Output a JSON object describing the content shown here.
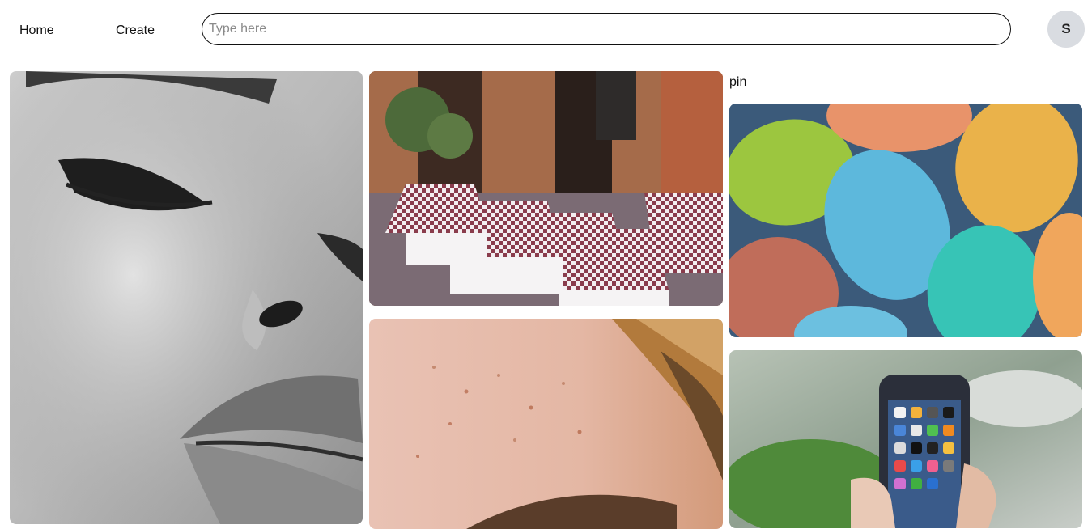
{
  "header": {
    "home_label": "Home",
    "create_label": "Create",
    "search": {
      "placeholder": "Type here",
      "value": ""
    },
    "avatar_initial": "S"
  },
  "pins": [
    {
      "title": "",
      "image": "black-and-white-face-closeup"
    },
    {
      "title": "",
      "image": "outdoor-cafe-checkered-tables"
    },
    {
      "title": "",
      "image": "freckled-eye-closeup"
    },
    {
      "title": "pin",
      "image": "colorful-easter-eggs"
    },
    {
      "title": "",
      "image": "hand-holding-smartphone"
    }
  ]
}
